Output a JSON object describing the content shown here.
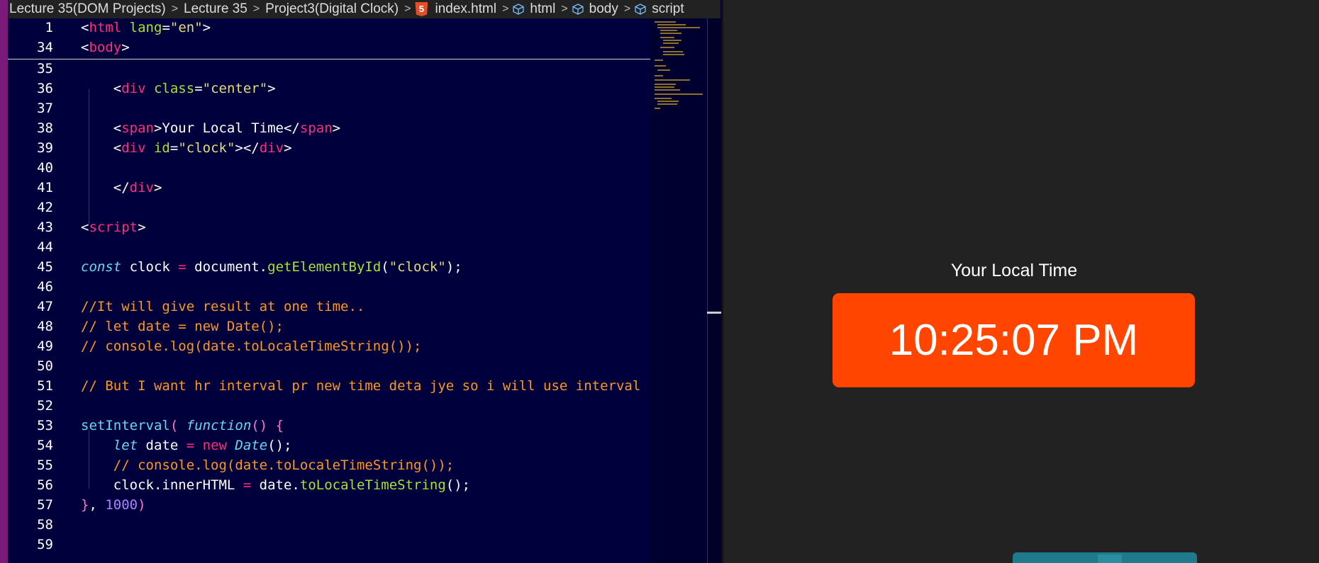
{
  "breadcrumb": {
    "items": [
      "Lecture 35(DOM Projects)",
      "Lecture 35",
      "Project3(Digital Clock)",
      "index.html",
      "html",
      "body",
      "script"
    ],
    "file_icon_label": "5"
  },
  "editor": {
    "sticky": [
      {
        "num": "1",
        "tokens": [
          [
            "p",
            "<"
          ],
          [
            "tag",
            "html"
          ],
          [
            "p",
            " "
          ],
          [
            "attr",
            "lang"
          ],
          [
            "p",
            "="
          ],
          [
            "str",
            "\"en\""
          ],
          [
            "p",
            ">"
          ]
        ]
      },
      {
        "num": "34",
        "tokens": [
          [
            "p",
            "<"
          ],
          [
            "tag",
            "body"
          ],
          [
            "p",
            ">"
          ]
        ]
      }
    ],
    "lines": [
      {
        "num": "35",
        "tokens": []
      },
      {
        "num": "36",
        "tokens": [
          [
            "p",
            "    <"
          ],
          [
            "tag",
            "div"
          ],
          [
            "p",
            " "
          ],
          [
            "attr",
            "class"
          ],
          [
            "p",
            "="
          ],
          [
            "str",
            "\"center\""
          ],
          [
            "p",
            ">"
          ]
        ]
      },
      {
        "num": "37",
        "tokens": []
      },
      {
        "num": "38",
        "tokens": [
          [
            "p",
            "    <"
          ],
          [
            "tag",
            "span"
          ],
          [
            "p",
            ">Your Local Time</"
          ],
          [
            "tag",
            "span"
          ],
          [
            "p",
            ">"
          ]
        ]
      },
      {
        "num": "39",
        "tokens": [
          [
            "p",
            "    <"
          ],
          [
            "tag",
            "div"
          ],
          [
            "p",
            " "
          ],
          [
            "attr",
            "id"
          ],
          [
            "p",
            "="
          ],
          [
            "str",
            "\"clock\""
          ],
          [
            "p",
            "></"
          ],
          [
            "tag",
            "div"
          ],
          [
            "p",
            ">"
          ]
        ]
      },
      {
        "num": "40",
        "tokens": []
      },
      {
        "num": "41",
        "tokens": [
          [
            "p",
            "    </"
          ],
          [
            "tag",
            "div"
          ],
          [
            "p",
            ">"
          ]
        ]
      },
      {
        "num": "42",
        "tokens": []
      },
      {
        "num": "43",
        "tokens": [
          [
            "p",
            "<"
          ],
          [
            "tag",
            "script"
          ],
          [
            "p",
            ">"
          ]
        ]
      },
      {
        "num": "44",
        "tokens": []
      },
      {
        "num": "45",
        "tokens": [
          [
            "kw",
            "const"
          ],
          [
            "p",
            " clock "
          ],
          [
            "op",
            "="
          ],
          [
            "p",
            " document."
          ],
          [
            "fn",
            "getElementById"
          ],
          [
            "p",
            "("
          ],
          [
            "str",
            "\"clock\""
          ],
          [
            "p",
            ");"
          ]
        ]
      },
      {
        "num": "46",
        "tokens": []
      },
      {
        "num": "47",
        "tokens": [
          [
            "cm",
            "//It will give result at one time.."
          ]
        ]
      },
      {
        "num": "48",
        "tokens": [
          [
            "cm",
            "// let date = new Date();"
          ]
        ]
      },
      {
        "num": "49",
        "tokens": [
          [
            "cm",
            "// console.log(date.toLocaleTimeString());"
          ]
        ]
      },
      {
        "num": "50",
        "tokens": []
      },
      {
        "num": "51",
        "tokens": [
          [
            "cm",
            "// But I want hr interval pr new time deta jye so i will use interval"
          ]
        ]
      },
      {
        "num": "52",
        "tokens": []
      },
      {
        "num": "53",
        "tokens": [
          [
            "fn2",
            "setInterval"
          ],
          [
            "brk",
            "("
          ],
          [
            "p",
            " "
          ],
          [
            "kw",
            "function"
          ],
          [
            "brk",
            "()"
          ],
          [
            "p",
            " "
          ],
          [
            "brk",
            "{"
          ]
        ]
      },
      {
        "num": "54",
        "tokens": [
          [
            "p",
            "    "
          ],
          [
            "kw",
            "let"
          ],
          [
            "p",
            " date "
          ],
          [
            "op",
            "="
          ],
          [
            "p",
            " "
          ],
          [
            "new",
            "new"
          ],
          [
            "p",
            " "
          ],
          [
            "cls",
            "Date"
          ],
          [
            "p",
            "();"
          ]
        ]
      },
      {
        "num": "55",
        "tokens": [
          [
            "p",
            "    "
          ],
          [
            "cm",
            "// console.log(date.toLocaleTimeString());"
          ]
        ]
      },
      {
        "num": "56",
        "tokens": [
          [
            "p",
            "    clock.innerHTML "
          ],
          [
            "op",
            "="
          ],
          [
            "p",
            " date."
          ],
          [
            "fn",
            "toLocaleTimeString"
          ],
          [
            "p",
            "();"
          ]
        ]
      },
      {
        "num": "57",
        "tokens": [
          [
            "brk",
            "}"
          ],
          [
            "p",
            ", "
          ],
          [
            "num",
            "1000"
          ],
          [
            "brk",
            ")"
          ]
        ]
      },
      {
        "num": "58",
        "tokens": []
      },
      {
        "num": "59",
        "tokens": []
      }
    ]
  },
  "preview": {
    "label": "Your Local Time",
    "time": "10:25:07 PM"
  },
  "colors": {
    "editor_bg": "#00003d",
    "clock_bg": "#ff4500",
    "preview_bg": "#222222"
  }
}
